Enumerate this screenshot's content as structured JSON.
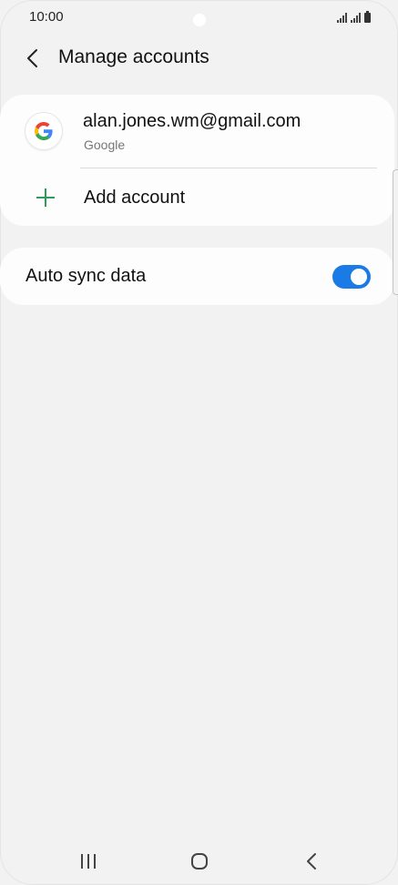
{
  "status_bar": {
    "time": "10:00",
    "icons": [
      "signal-icon",
      "signal-icon",
      "battery-icon"
    ]
  },
  "header": {
    "title": "Manage accounts",
    "back_icon": "chevron-left-icon"
  },
  "accounts": {
    "items": [
      {
        "email": "alan.jones.wm@gmail.com",
        "type": "Google",
        "icon": "google-logo"
      }
    ],
    "add_label": "Add account",
    "add_icon": "plus-icon"
  },
  "sync": {
    "label": "Auto sync data",
    "enabled": true
  },
  "nav_bar": {
    "buttons": [
      "recents-icon",
      "home-icon",
      "back-icon"
    ]
  },
  "colors": {
    "background": "#f2f2f2",
    "card": "#fdfdfd",
    "toggle_on": "#1a7be6",
    "add_plus": "#2a9d57"
  }
}
